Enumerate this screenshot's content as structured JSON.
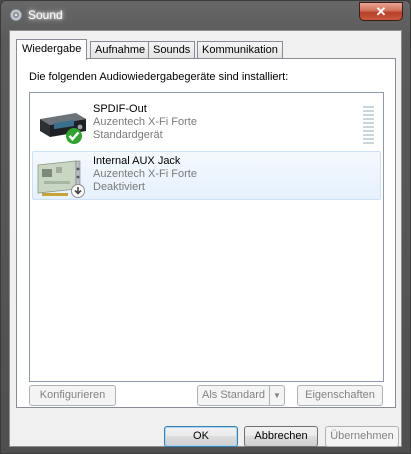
{
  "window": {
    "title": "Sound",
    "close_glyph": "✕"
  },
  "tabs": [
    {
      "label": "Wiedergabe"
    },
    {
      "label": "Aufnahme"
    },
    {
      "label": "Sounds"
    },
    {
      "label": "Kommunikation"
    }
  ],
  "panel": {
    "label": "Die folgenden Audiowiedergabegeräte sind installiert:"
  },
  "devices": [
    {
      "name": "SPDIF-Out",
      "vendor": "Auzentech X-Fi Forte",
      "status": "Standardgerät",
      "icon": "spdif-device-icon",
      "badge": "default-check-icon",
      "selected": false
    },
    {
      "name": "Internal AUX Jack",
      "vendor": "Auzentech X-Fi Forte",
      "status": "Deaktiviert",
      "icon": "sound-card-icon",
      "badge": "disabled-arrow-icon",
      "selected": true
    }
  ],
  "buttons": {
    "configure": "Konfigurieren",
    "set_default": "Als Standard",
    "properties": "Eigenschaften",
    "ok": "OK",
    "cancel": "Abbrechen",
    "apply": "Übernehmen"
  },
  "colors": {
    "accent_check": "#2fa52f",
    "selection": "#e6f1fc",
    "close_red": "#c9583e"
  }
}
